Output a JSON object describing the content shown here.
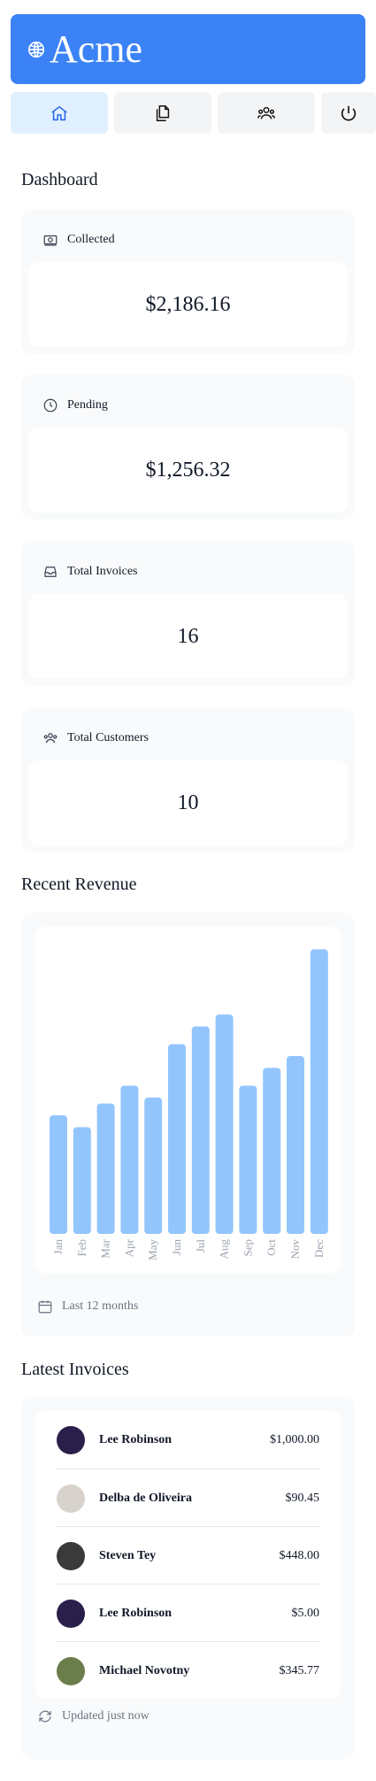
{
  "header": {
    "logo_text": "Acme"
  },
  "nav": [
    {
      "name": "home",
      "icon": "home-icon",
      "active": true
    },
    {
      "name": "invoices",
      "icon": "documents-icon",
      "active": false
    },
    {
      "name": "customers",
      "icon": "users-icon",
      "active": false
    },
    {
      "name": "sign-out",
      "icon": "power-icon",
      "active": false
    }
  ],
  "dashboard": {
    "title": "Dashboard",
    "cards": [
      {
        "label": "Collected",
        "value": "$2,186.16",
        "icon": "banknotes-icon"
      },
      {
        "label": "Pending",
        "value": "$1,256.32",
        "icon": "clock-icon"
      },
      {
        "label": "Total Invoices",
        "value": "16",
        "icon": "inbox-icon"
      },
      {
        "label": "Total Customers",
        "value": "10",
        "icon": "users-icon"
      }
    ]
  },
  "revenue": {
    "title": "Recent Revenue",
    "footer": "Last 12 months"
  },
  "chart_data": {
    "type": "bar",
    "categories": [
      "Jan",
      "Feb",
      "Mar",
      "Apr",
      "May",
      "Jun",
      "Jul",
      "Aug",
      "Sep",
      "Oct",
      "Nov",
      "Dec"
    ],
    "values": [
      2000,
      1800,
      2200,
      2500,
      2300,
      3200,
      3500,
      3700,
      2500,
      2800,
      3000,
      4800
    ],
    "ylim": [
      0,
      5000
    ],
    "color": "#93c5fd"
  },
  "invoices": {
    "title": "Latest Invoices",
    "items": [
      {
        "name": "Lee Robinson",
        "amount": "$1,000.00",
        "avatar_color": "#2a1f4a"
      },
      {
        "name": "Delba de Oliveira",
        "amount": "$90.45",
        "avatar_color": "#d8d2cc"
      },
      {
        "name": "Steven Tey",
        "amount": "$448.00",
        "avatar_color": "#3a3a3a"
      },
      {
        "name": "Lee Robinson",
        "amount": "$5.00",
        "avatar_color": "#2a1f4a"
      },
      {
        "name": "Michael Novotny",
        "amount": "$345.77",
        "avatar_color": "#6b7d4a"
      }
    ],
    "footer": "Updated just now"
  }
}
